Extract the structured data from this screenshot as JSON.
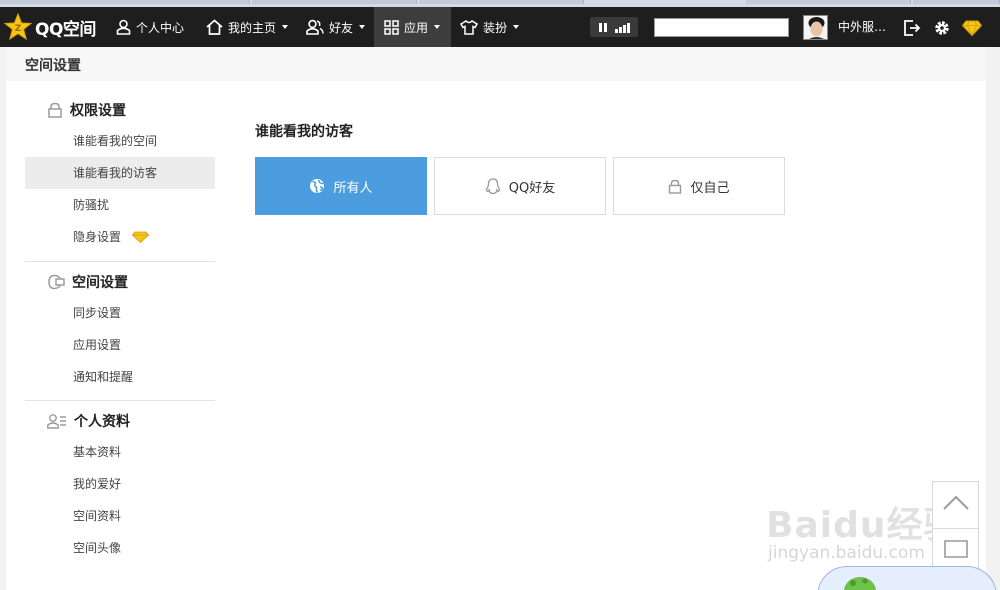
{
  "app": {
    "logo_text": "QQ空间"
  },
  "nav": {
    "items": [
      {
        "label": "个人中心",
        "icon": "person-icon",
        "has_caret": false
      },
      {
        "label": "我的主页",
        "icon": "home-icon",
        "has_caret": true
      },
      {
        "label": "好友",
        "icon": "friends-icon",
        "has_caret": true
      },
      {
        "label": "应用",
        "icon": "grid-icon",
        "has_caret": true,
        "active": true
      },
      {
        "label": "装扮",
        "icon": "shirt-icon",
        "has_caret": true
      }
    ]
  },
  "top_right": {
    "search_value": "",
    "username": "中外服…",
    "icons": [
      "logout-icon",
      "gear-icon",
      "diamond-icon"
    ]
  },
  "page": {
    "title": "空间设置"
  },
  "sidebar": {
    "sections": [
      {
        "title": "权限设置",
        "icon": "lock-icon",
        "items": [
          {
            "label": "谁能看我的空间"
          },
          {
            "label": "谁能看我的访客",
            "selected": true
          },
          {
            "label": "防骚扰"
          },
          {
            "label": "隐身设置",
            "vip": true
          }
        ]
      },
      {
        "title": "空间设置",
        "icon": "sync-icon",
        "items": [
          {
            "label": "同步设置"
          },
          {
            "label": "应用设置"
          },
          {
            "label": "通知和提醒"
          }
        ]
      },
      {
        "title": "个人资料",
        "icon": "profile-icon",
        "items": [
          {
            "label": "基本资料"
          },
          {
            "label": "我的爱好"
          },
          {
            "label": "空间资料"
          },
          {
            "label": "空间头像"
          }
        ]
      }
    ]
  },
  "main": {
    "heading": "谁能看我的访客",
    "options": [
      {
        "label": "所有人",
        "icon": "globe-icon",
        "selected": true
      },
      {
        "label": "QQ好友",
        "icon": "qq-penguin-icon",
        "selected": false
      },
      {
        "label": "仅自己",
        "icon": "lock-icon",
        "selected": false
      }
    ]
  },
  "watermark": {
    "line1": "Baidu经验",
    "line2": "jingyan.baidu.com"
  },
  "colors": {
    "accent": "#4b9de0",
    "topbar": "#1e1e1e",
    "vip_gold": "#f5c518"
  }
}
